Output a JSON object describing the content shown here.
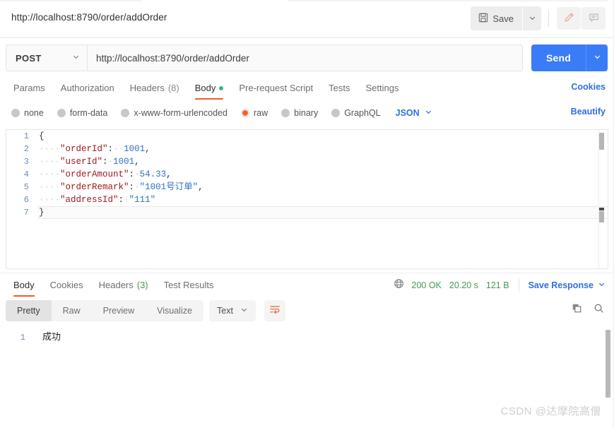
{
  "topbar": {
    "request_name": "http://localhost:8790/order/addOrder",
    "save_label": "Save",
    "save_icon": "floppy-disk-icon",
    "save_caret_icon": "chevron-down-icon",
    "edit_icon": "pencil-icon",
    "comment_icon": "comment-icon"
  },
  "request": {
    "method": "POST",
    "method_caret_icon": "chevron-down-icon",
    "url": "http://localhost:8790/order/addOrder",
    "send_label": "Send",
    "send_caret_icon": "chevron-down-icon"
  },
  "request_tabs": {
    "items": [
      {
        "label": "Params",
        "count": "",
        "active": false,
        "dot": false
      },
      {
        "label": "Authorization",
        "count": "",
        "active": false,
        "dot": false
      },
      {
        "label": "Headers",
        "count": "(8)",
        "active": false,
        "dot": false
      },
      {
        "label": "Body",
        "count": "",
        "active": true,
        "dot": true
      },
      {
        "label": "Pre-request Script",
        "count": "",
        "active": false,
        "dot": false
      },
      {
        "label": "Tests",
        "count": "",
        "active": false,
        "dot": false
      },
      {
        "label": "Settings",
        "count": "",
        "active": false,
        "dot": false
      }
    ],
    "cookies_link": "Cookies"
  },
  "body_types": {
    "options": [
      {
        "label": "none",
        "selected": false
      },
      {
        "label": "form-data",
        "selected": false
      },
      {
        "label": "x-www-form-urlencoded",
        "selected": false
      },
      {
        "label": "raw",
        "selected": true
      },
      {
        "label": "binary",
        "selected": false
      },
      {
        "label": "GraphQL",
        "selected": false
      }
    ],
    "format": "JSON",
    "format_caret_icon": "chevron-down-icon",
    "beautify_link": "Beautify"
  },
  "request_body": {
    "lines": [
      {
        "num": "1",
        "tokens": [
          {
            "t": "punc",
            "v": "{"
          }
        ],
        "active": false
      },
      {
        "num": "2",
        "tokens": [
          {
            "t": "ws",
            "v": "····"
          },
          {
            "t": "key",
            "v": "\"orderId\""
          },
          {
            "t": "punc",
            "v": ":"
          },
          {
            "t": "ws",
            "v": "··"
          },
          {
            "t": "num",
            "v": "1001"
          },
          {
            "t": "punc",
            "v": ","
          }
        ],
        "active": false
      },
      {
        "num": "3",
        "tokens": [
          {
            "t": "ws",
            "v": "····"
          },
          {
            "t": "key",
            "v": "\"userId\""
          },
          {
            "t": "punc",
            "v": ":"
          },
          {
            "t": "ws",
            "v": "·"
          },
          {
            "t": "num",
            "v": "1001"
          },
          {
            "t": "punc",
            "v": ","
          }
        ],
        "active": false
      },
      {
        "num": "4",
        "tokens": [
          {
            "t": "ws",
            "v": "····"
          },
          {
            "t": "key",
            "v": "\"orderAmount\""
          },
          {
            "t": "punc",
            "v": ":"
          },
          {
            "t": "ws",
            "v": "·"
          },
          {
            "t": "num",
            "v": "54.33"
          },
          {
            "t": "punc",
            "v": ","
          }
        ],
        "active": false
      },
      {
        "num": "5",
        "tokens": [
          {
            "t": "ws",
            "v": "····"
          },
          {
            "t": "key",
            "v": "\"orderRemark\""
          },
          {
            "t": "punc",
            "v": ":"
          },
          {
            "t": "ws",
            "v": "·"
          },
          {
            "t": "str",
            "v": "\"1001号订单\""
          },
          {
            "t": "punc",
            "v": ","
          }
        ],
        "active": false
      },
      {
        "num": "6",
        "tokens": [
          {
            "t": "ws",
            "v": "····"
          },
          {
            "t": "key",
            "v": "\"addressId\""
          },
          {
            "t": "punc",
            "v": ":"
          },
          {
            "t": "ws",
            "v": "·"
          },
          {
            "t": "str",
            "v": "\"111\""
          }
        ],
        "active": false
      },
      {
        "num": "7",
        "tokens": [
          {
            "t": "punc",
            "v": "}"
          }
        ],
        "active": true
      }
    ]
  },
  "response_tabs": {
    "items": [
      {
        "label": "Body",
        "count": "",
        "active": true
      },
      {
        "label": "Cookies",
        "count": "",
        "active": false
      },
      {
        "label": "Headers",
        "count": "(3)",
        "active": false
      },
      {
        "label": "Test Results",
        "count": "",
        "active": false
      }
    ],
    "globe_icon": "globe-icon",
    "status": "200 OK",
    "time": "20.20 s",
    "size": "121 B",
    "save_response_label": "Save Response",
    "save_response_caret_icon": "chevron-down-icon"
  },
  "response_toolbar": {
    "views": [
      {
        "label": "Pretty",
        "active": true
      },
      {
        "label": "Raw",
        "active": false
      },
      {
        "label": "Preview",
        "active": false
      },
      {
        "label": "Visualize",
        "active": false
      }
    ],
    "format": "Text",
    "format_caret_icon": "chevron-down-icon",
    "wrap_icon": "word-wrap-icon",
    "copy_icon": "copy-icon",
    "search_icon": "search-icon"
  },
  "response_body": {
    "lines": [
      {
        "num": "1",
        "text": "成功"
      }
    ]
  },
  "watermark": "CSDN @达摩院高僧",
  "colors": {
    "accent_orange": "#ef5b25",
    "send_blue": "#3a7cf7",
    "link_blue": "#2f6ee0",
    "status_green": "#3f9c58",
    "json_key": "#a31a1a",
    "json_value": "#2f72c4"
  }
}
